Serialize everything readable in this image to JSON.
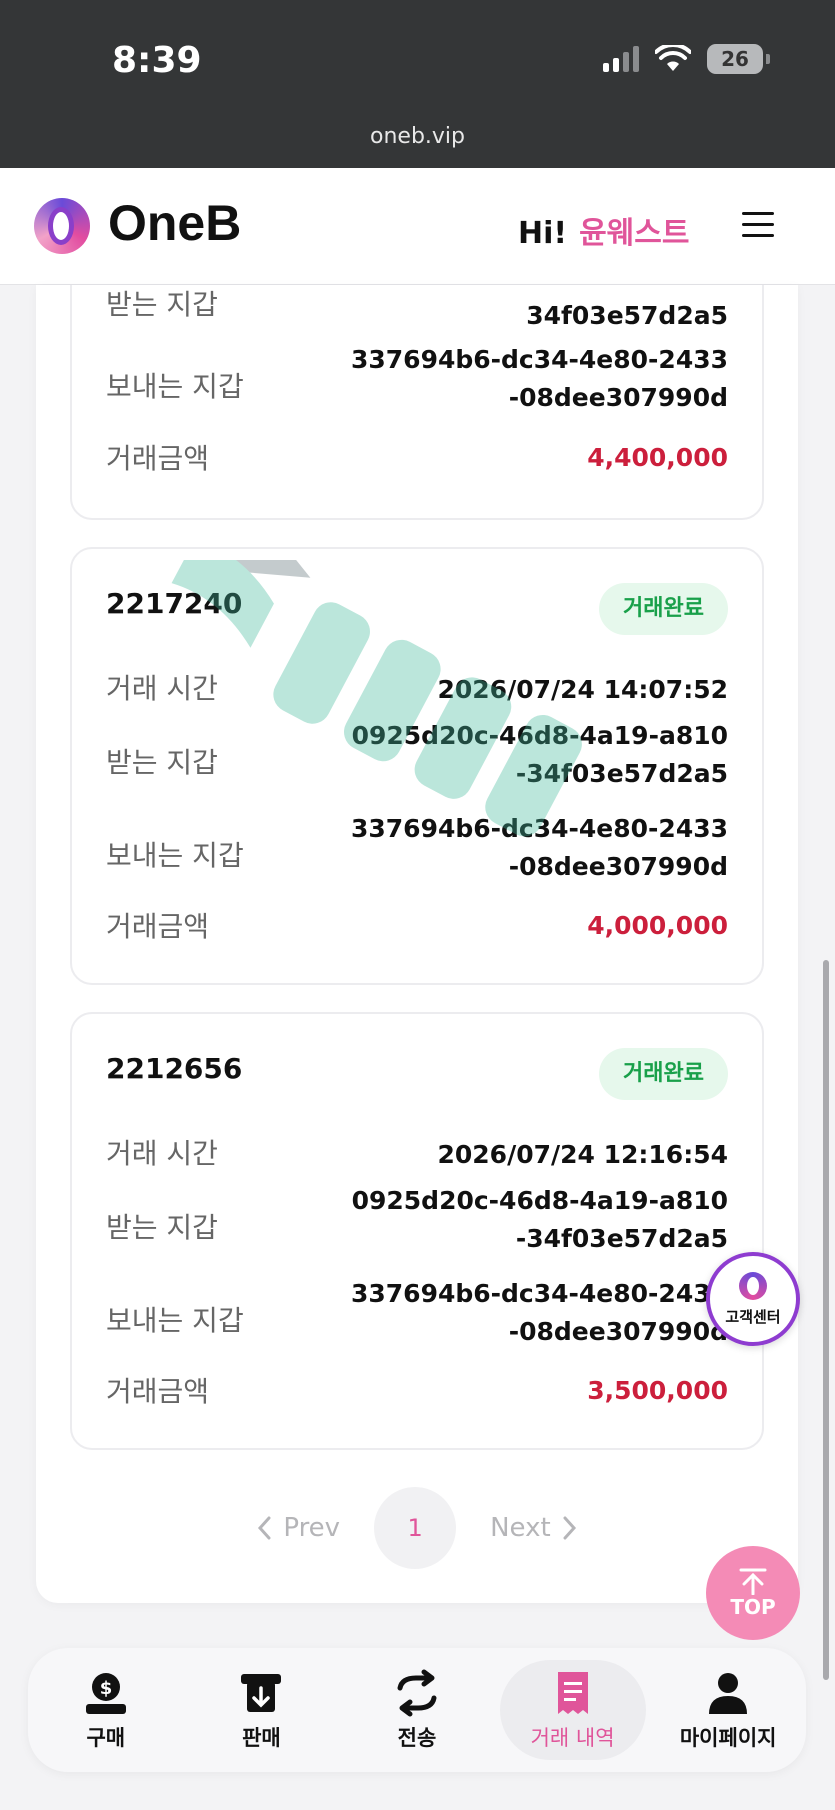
{
  "status_bar": {
    "time": "8:39",
    "battery": "26",
    "url": "oneb.vip"
  },
  "header": {
    "brand": "OneB",
    "greeting": "Hi!",
    "username": "윤웨스트"
  },
  "labels": {
    "tx_time": "거래 시간",
    "receive_wallet": "받는 지갑",
    "send_wallet": "보내는 지갑",
    "amount": "거래금액"
  },
  "partial_card": {
    "receive_wallet_tail": "34f03e57d2a5",
    "send_wallet": "337694b6-dc34-4e80-2433-08dee307990d",
    "amount": "4,400,000"
  },
  "transactions": [
    {
      "id": "2217240",
      "status": "거래완료",
      "time": "2026/07/24 14:07:52",
      "receive_wallet": "0925d20c-46d8-4a19-a810-34f03e57d2a5",
      "send_wallet": "337694b6-dc34-4e80-2433-08dee307990d",
      "amount": "4,000,000"
    },
    {
      "id": "2212656",
      "status": "거래완료",
      "time": "2026/07/24 12:16:54",
      "receive_wallet": "0925d20c-46d8-4a19-a810-34f03e57d2a5",
      "send_wallet": "337694b6-dc34-4e80-2433-08dee307990d",
      "amount": "3,500,000"
    }
  ],
  "pagination": {
    "prev": "Prev",
    "current": "1",
    "next": "Next"
  },
  "floating": {
    "customer_center": "고객센터",
    "top": "TOP"
  },
  "bottom_nav": [
    {
      "label": "구매",
      "icon": "buy-icon"
    },
    {
      "label": "판매",
      "icon": "sell-icon"
    },
    {
      "label": "전송",
      "icon": "transfer-icon"
    },
    {
      "label": "거래 내역",
      "icon": "receipt-icon",
      "active": true
    },
    {
      "label": "마이페이지",
      "icon": "user-icon"
    }
  ],
  "colors": {
    "accent": "#e0559a",
    "amount": "#cc1f3c",
    "badge_bg": "#e6f8ec",
    "badge_text": "#19a04a"
  }
}
